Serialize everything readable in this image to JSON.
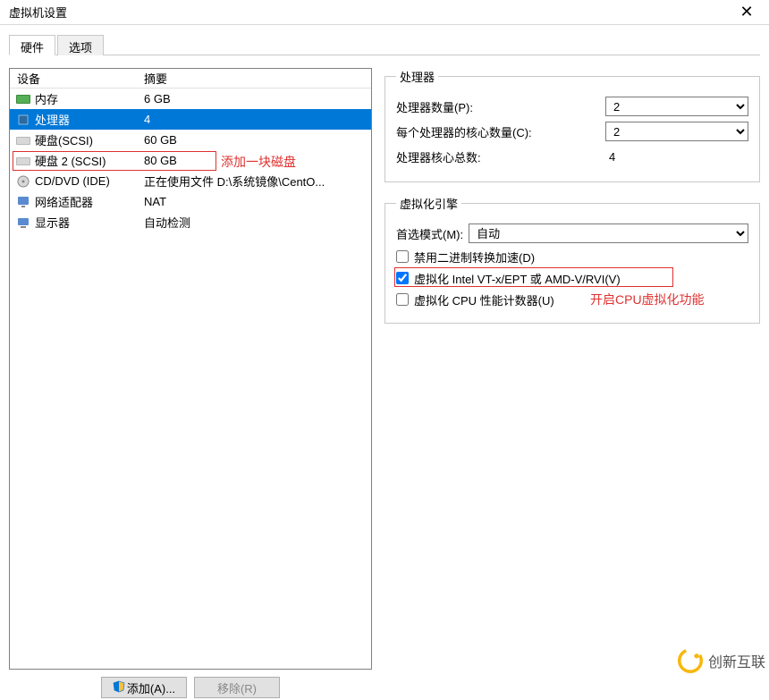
{
  "window": {
    "title": "虚拟机设置"
  },
  "tabs": {
    "hardware": "硬件",
    "options": "选项"
  },
  "headers": {
    "device": "设备",
    "summary": "摘要"
  },
  "devices": [
    {
      "icon": "memory",
      "name": "内存",
      "summary": "6 GB"
    },
    {
      "icon": "processor",
      "name": "处理器",
      "summary": "4"
    },
    {
      "icon": "disk",
      "name": "硬盘(SCSI)",
      "summary": "60 GB"
    },
    {
      "icon": "disk",
      "name": "硬盘 2 (SCSI)",
      "summary": "80 GB"
    },
    {
      "icon": "cd",
      "name": "CD/DVD (IDE)",
      "summary": "正在使用文件 D:\\系统镜像\\CentO..."
    },
    {
      "icon": "network",
      "name": "网络适配器",
      "summary": "NAT"
    },
    {
      "icon": "display",
      "name": "显示器",
      "summary": "自动检测"
    }
  ],
  "annotations": {
    "add_disk": "添加一块磁盘",
    "enable_vtx": "开启CPU虚拟化功能"
  },
  "buttons": {
    "add": "添加(A)...",
    "remove": "移除(R)"
  },
  "processor_group": {
    "legend": "处理器",
    "proc_count_label": "处理器数量(P):",
    "proc_count_value": "2",
    "cores_per_label": "每个处理器的核心数量(C):",
    "cores_per_value": "2",
    "total_label": "处理器核心总数:",
    "total_value": "4"
  },
  "virt_group": {
    "legend": "虚拟化引擎",
    "mode_label": "首选模式(M):",
    "mode_value": "自动",
    "chk_disable_binary": "禁用二进制转换加速(D)",
    "chk_vtx": "虚拟化 Intel VT-x/EPT 或 AMD-V/RVI(V)",
    "chk_perf": "虚拟化 CPU 性能计数器(U)"
  },
  "watermark": "创新互联"
}
